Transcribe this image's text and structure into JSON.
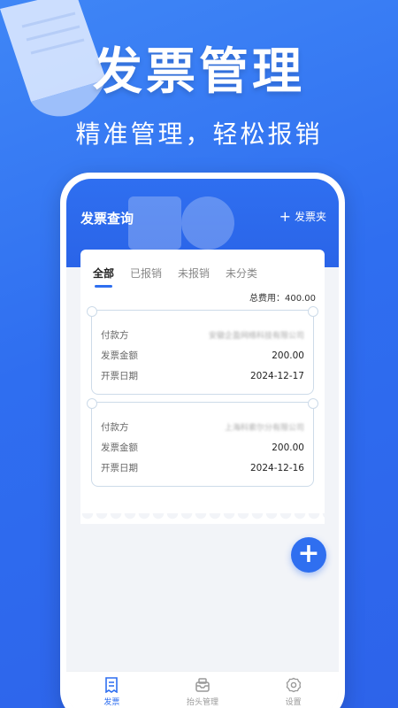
{
  "hero": {
    "title": "发票管理",
    "subtitle": "精准管理，轻松报销"
  },
  "app": {
    "title": "发票查询",
    "folder_button": "发票夹"
  },
  "tabs": [
    {
      "label": "全部",
      "active": true
    },
    {
      "label": "已报销",
      "active": false
    },
    {
      "label": "未报销",
      "active": false
    },
    {
      "label": "未分类",
      "active": false
    }
  ],
  "total": {
    "label": "总费用：",
    "value": "400.00"
  },
  "invoices": [
    {
      "payer_label": "付款方",
      "payer_value": "安徽企盈网络科技有限公司",
      "amount_label": "发票金额",
      "amount_value": "200.00",
      "date_label": "开票日期",
      "date_value": "2024-12-17"
    },
    {
      "payer_label": "付款方",
      "payer_value": "上海科索尔分有限公司",
      "amount_label": "发票金额",
      "amount_value": "200.00",
      "date_label": "开票日期",
      "date_value": "2024-12-16"
    }
  ],
  "fab_icon": "plus-icon",
  "tabbar": [
    {
      "label": "发票",
      "icon": "invoice-icon",
      "active": true
    },
    {
      "label": "抬头管理",
      "icon": "inbox-icon",
      "active": false
    },
    {
      "label": "设置",
      "icon": "gear-icon",
      "active": false
    }
  ],
  "colors": {
    "primary": "#2f6ff0",
    "background": "#3f86f6",
    "screen": "#f2f4f8"
  }
}
